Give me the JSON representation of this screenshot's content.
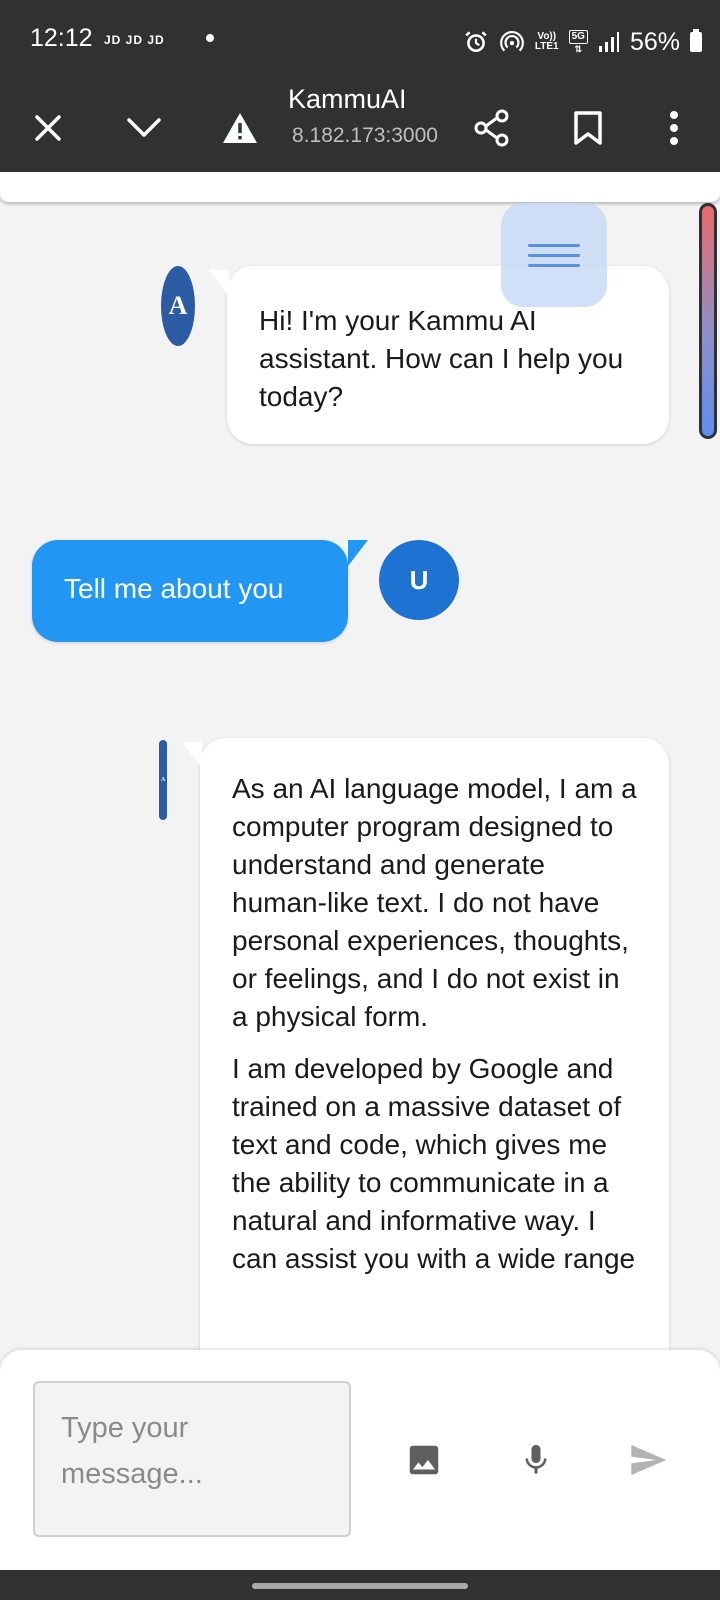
{
  "status_bar": {
    "time": "12:12",
    "carriers": "JD JD JD",
    "network_top": "Vo))",
    "network_bottom": "LTE1",
    "network_5g": "5G",
    "battery": "56%"
  },
  "browser": {
    "title": "KammuAI",
    "url": "8.182.173:3000",
    "icons": [
      "close-icon",
      "chevron-down-icon",
      "warning-icon",
      "share-icon",
      "bookmark-icon",
      "more-vert-icon"
    ]
  },
  "chat": {
    "ai_avatar_letter": "A",
    "user_avatar_letter": "U",
    "messages": [
      {
        "sender": "ai",
        "text": "Hi! I'm your Kammu AI assistant. How can I help you today?"
      },
      {
        "sender": "user",
        "text": "Tell me about you"
      },
      {
        "sender": "ai",
        "paragraphs": [
          "As an AI language model, I am a computer program designed to understand and generate human-like text. I do not have personal experiences, thoughts, or feelings, and I do not exist in a physical form.",
          "I am developed by Google and trained on a massive dataset of text and code, which gives me the ability to communicate in a natural and informative way. I can assist you with a wide range"
        ]
      }
    ]
  },
  "composer": {
    "placeholder": "Type your message...",
    "icons": [
      "image-icon",
      "mic-icon",
      "send-icon"
    ]
  },
  "colors": {
    "user_bubble": "#2196f3",
    "user_avatar": "#1e72d2",
    "ai_avatar": "#2b5ba3",
    "chrome_dark": "#2f3133"
  }
}
